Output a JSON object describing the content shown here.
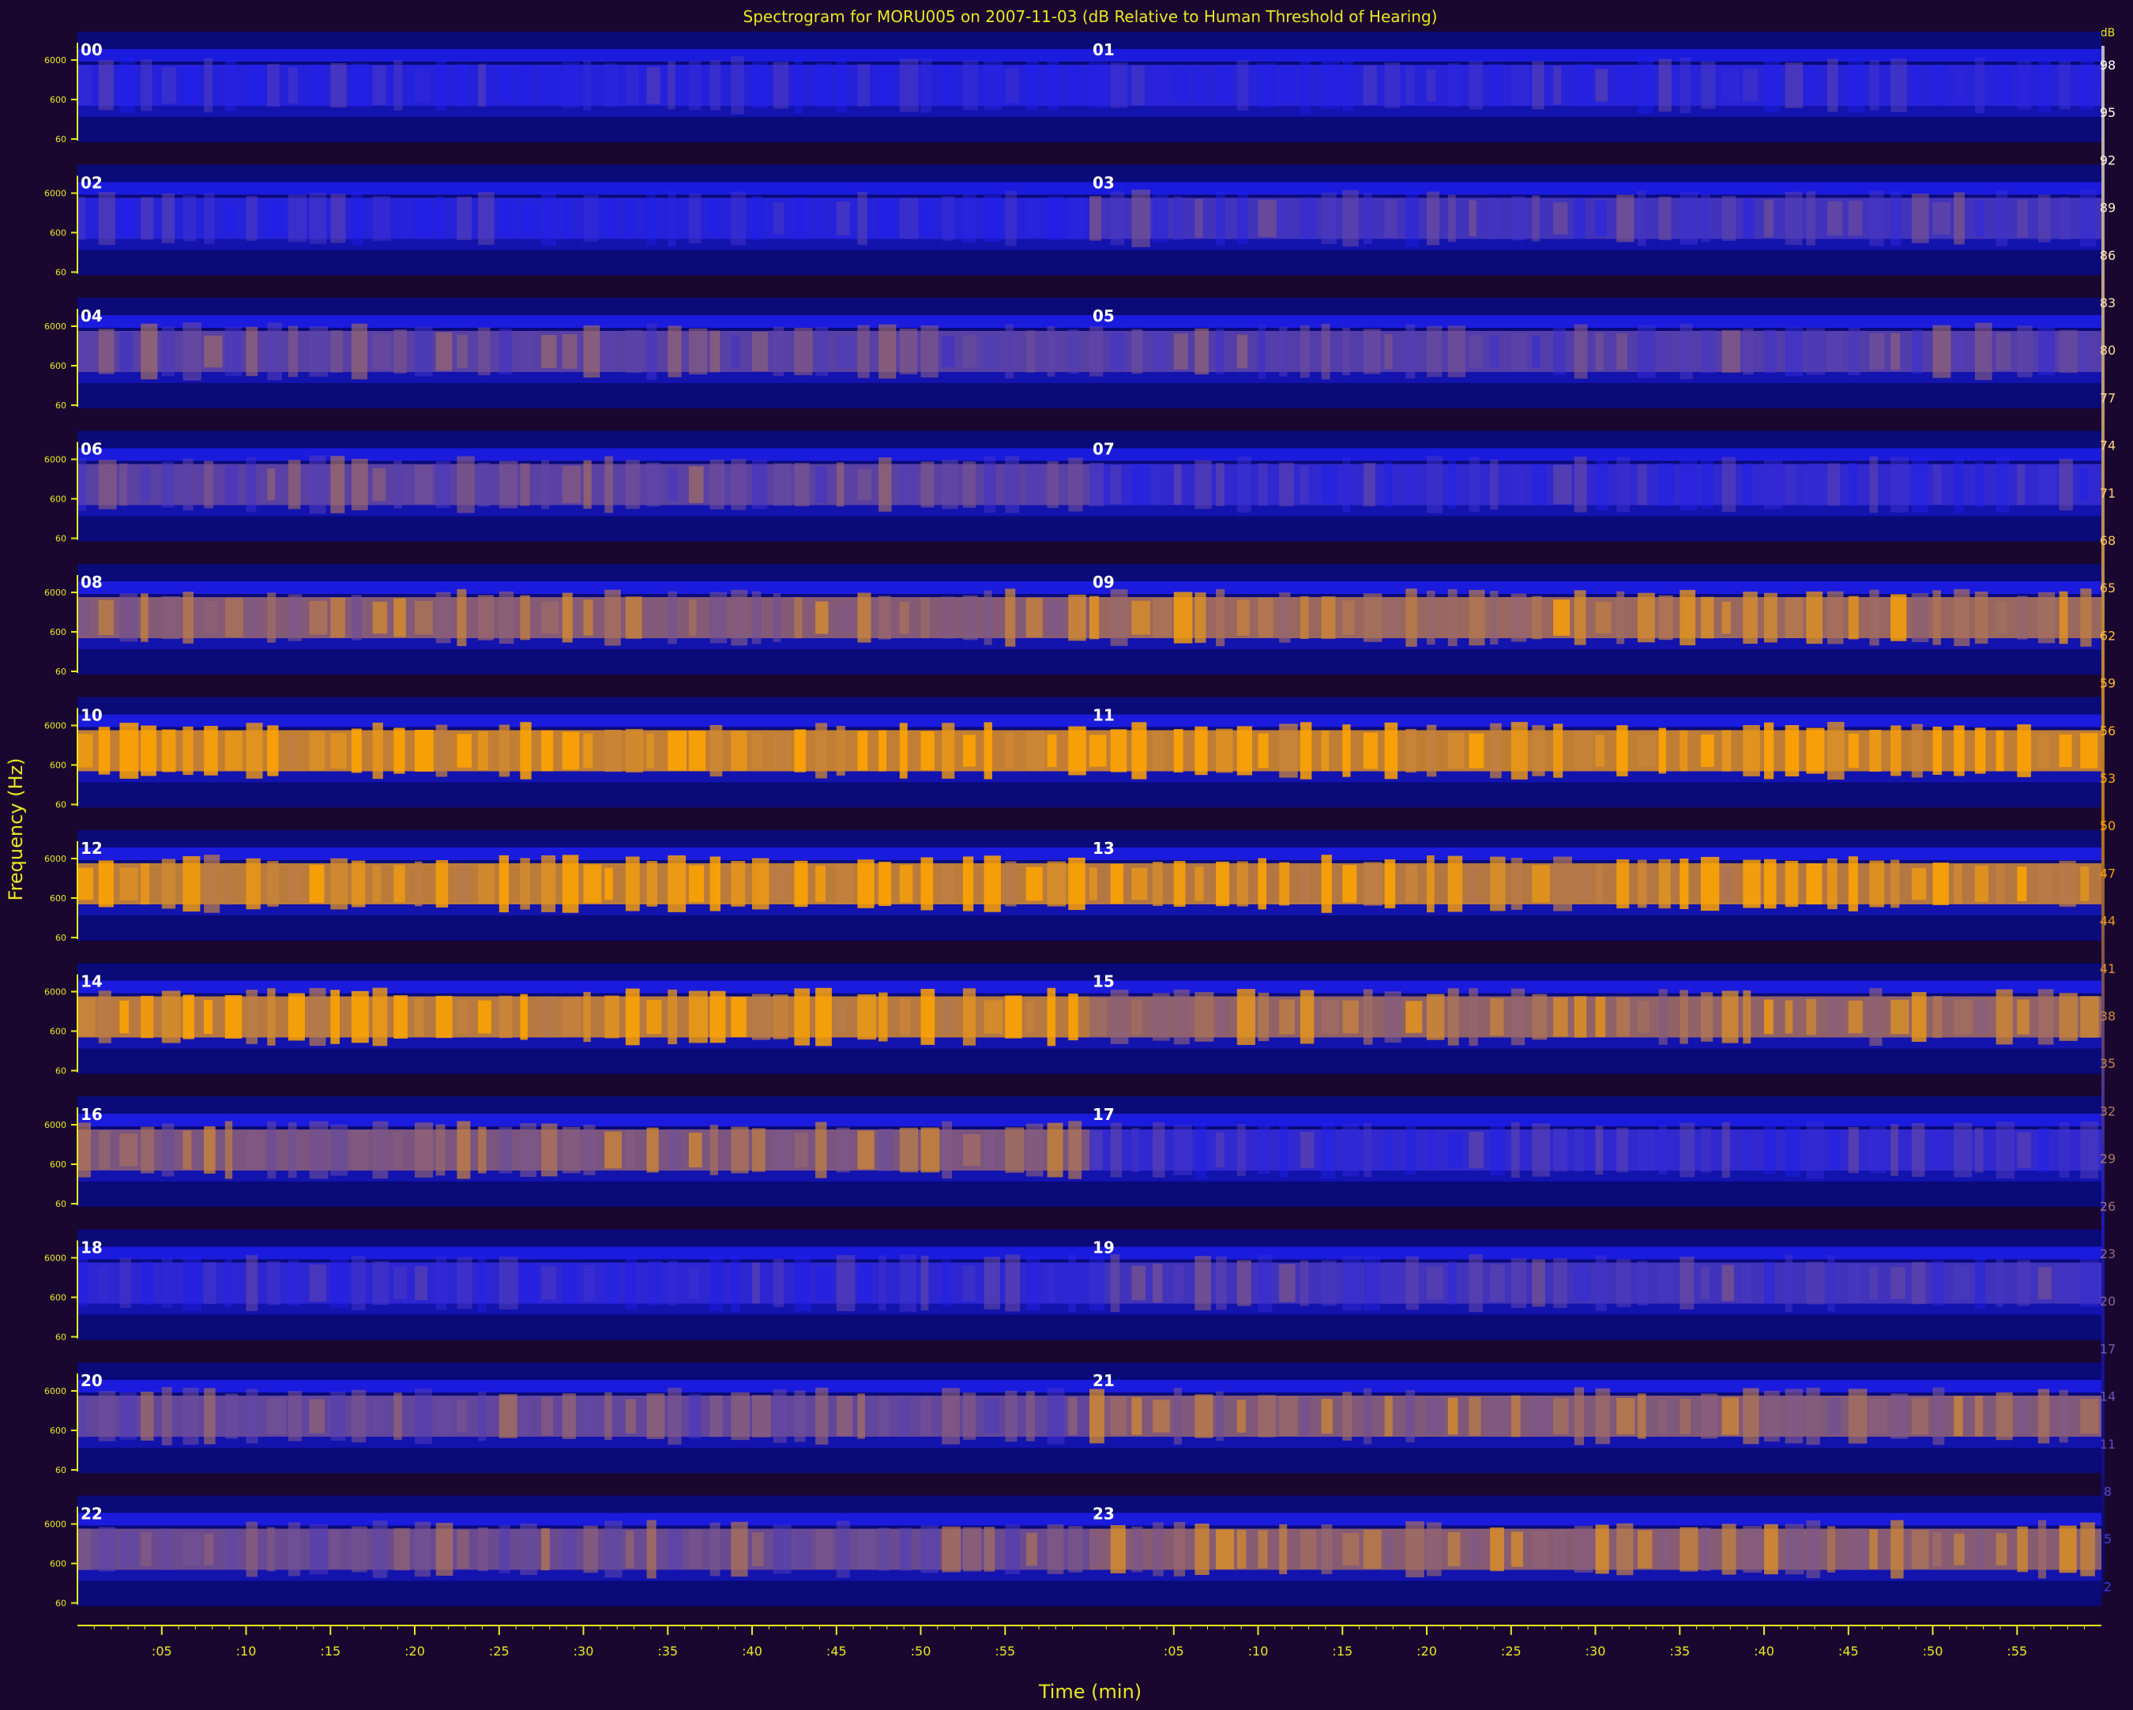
{
  "chart_data": {
    "type": "heatmap",
    "title": "Spectrogram for MORU005 on 2007-11-03 (dB Relative to Human Threshold of Hearing)",
    "xlabel": "Time (min)",
    "ylabel": "Frequency (Hz)",
    "x_tick_labels": [
      ":05",
      ":10",
      ":15",
      ":20",
      ":25",
      ":30",
      ":35",
      ":40",
      ":45",
      ":50",
      ":55"
    ],
    "y_tick_labels": [
      "6000",
      "600",
      "60"
    ],
    "colorbar_ticks": [
      98,
      95,
      92,
      89,
      86,
      83,
      80,
      77,
      74,
      71,
      68,
      65,
      62,
      59,
      56,
      53,
      50,
      47,
      44,
      41,
      38,
      35,
      32,
      29,
      26,
      23,
      20,
      17,
      14,
      11,
      8,
      5,
      2
    ],
    "colorbar_unit": "dB",
    "hours": [
      "00",
      "01",
      "02",
      "03",
      "04",
      "05",
      "06",
      "07",
      "08",
      "09",
      "10",
      "11",
      "12",
      "13",
      "14",
      "15",
      "16",
      "17",
      "18",
      "19",
      "20",
      "21",
      "22",
      "23"
    ],
    "hour_intensity": [
      0.05,
      0.07,
      0.06,
      0.22,
      0.35,
      0.32,
      0.36,
      0.12,
      0.6,
      0.72,
      0.96,
      0.95,
      0.92,
      0.88,
      0.9,
      0.68,
      0.55,
      0.12,
      0.1,
      0.22,
      0.4,
      0.58,
      0.45,
      0.62
    ],
    "colors": {
      "background": "#1a0730",
      "plot_bg": "#0a0a78",
      "band_low": "#1e1ef0",
      "band_high": "#ffa500",
      "axis": "#e8e820",
      "label": "#ffffff"
    }
  }
}
